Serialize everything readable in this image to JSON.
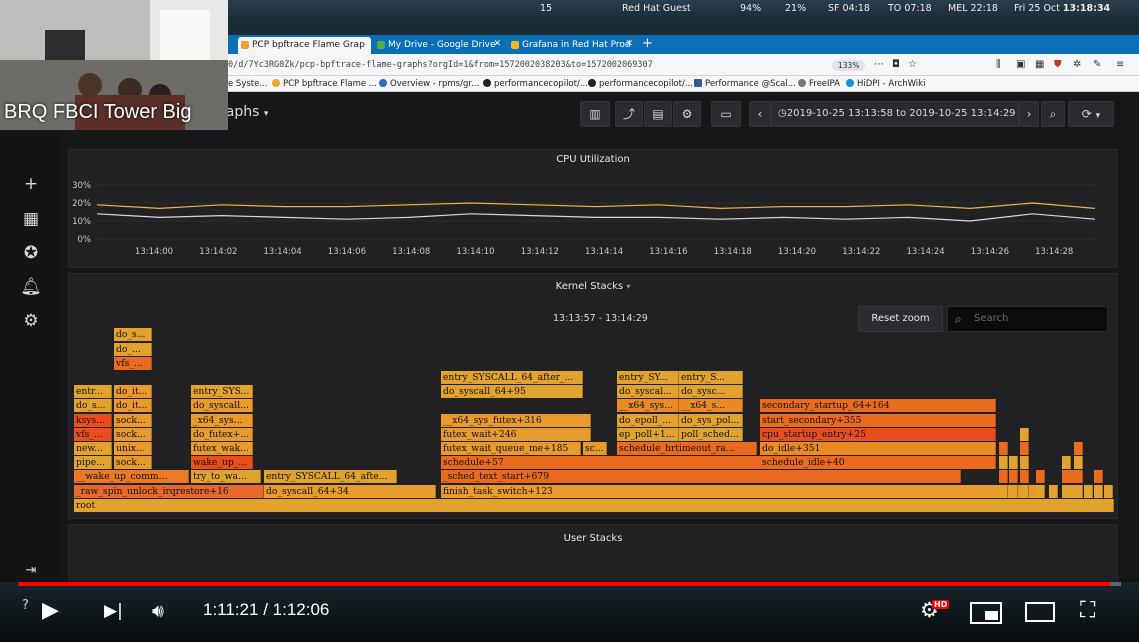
{
  "os_bar": {
    "left_num": "15",
    "user": "Red Hat Guest",
    "battery": "94%",
    "cpu": "21%",
    "clocks": [
      {
        "label": "SF",
        "time": "04:18"
      },
      {
        "label": "TO",
        "time": "07:18"
      },
      {
        "label": "MEL",
        "time": "22:18"
      }
    ],
    "date": "Fri 25 Oct",
    "date_time": "13:18:34"
  },
  "browser": {
    "tabs": [
      {
        "label": "PCP bpftrace Flame Grap",
        "active": true,
        "icon_color": "#f0a030"
      },
      {
        "label": "My Drive - Google Drive",
        "active": false,
        "icon_color": "#4caf50"
      },
      {
        "label": "Grafana in Red Hat Prod",
        "active": false,
        "icon_color": "#f5b623"
      }
    ],
    "url": "0/d/7Yc3RG0Zk/pcp-bpftrace-flame-graphs?orgId=1&from=1572002038203&to=1572002069307",
    "zoom": "133%",
    "bookmarks": [
      {
        "label": "e Syste...",
        "color": "#e0e0e0"
      },
      {
        "label": "PCP bpftrace Flame ...",
        "color": "#f0a030"
      },
      {
        "label": "Overview - rpms/gr...",
        "color": "#3366cc"
      },
      {
        "label": "performancecopilot/...",
        "color": "#222222"
      },
      {
        "label": "performancecopilot/...",
        "color": "#222222"
      },
      {
        "label": "Performance @Scal...",
        "color": "#3b5998"
      },
      {
        "label": "FreeIPA",
        "color": "#777777"
      },
      {
        "label": "HiDPI - ArchWiki",
        "color": "#1793d1"
      }
    ]
  },
  "grafana": {
    "dashboard_title": "raphs",
    "time_range": "2019-10-25 13:13:58 to 2019-10-25 13:14:29",
    "side_icons": [
      "plus-icon",
      "dashboards-icon",
      "explore-icon",
      "alerting-icon",
      "settings-icon",
      "signin-icon"
    ],
    "cpu_panel": {
      "title": "CPU Utilization",
      "y_ticks": [
        "30%",
        "20%",
        "10%",
        "0%"
      ],
      "x_ticks": [
        "13:14:00",
        "13:14:02",
        "13:14:04",
        "13:14:06",
        "13:14:08",
        "13:14:10",
        "13:14:12",
        "13:14:14",
        "13:14:16",
        "13:14:18",
        "13:14:20",
        "13:14:22",
        "13:14:24",
        "13:14:26",
        "13:14:28"
      ]
    },
    "kernel_panel": {
      "title": "Kernel Stacks",
      "reset_zoom": "Reset zoom",
      "search_placeholder": "Search",
      "time_label": "13:13:57 - 13:14:29"
    },
    "user_panel": {
      "title": "User Stacks"
    }
  },
  "chart_data": {
    "type": "line",
    "title": "CPU Utilization",
    "xlabel": "",
    "ylabel": "",
    "ylim": [
      0,
      30
    ],
    "x": [
      "13:13:58",
      "13:14:00",
      "13:14:02",
      "13:14:04",
      "13:14:06",
      "13:14:08",
      "13:14:10",
      "13:14:12",
      "13:14:14",
      "13:14:16",
      "13:14:18",
      "13:14:20",
      "13:14:22",
      "13:14:24",
      "13:14:26",
      "13:14:28",
      "13:14:29"
    ],
    "series": [
      {
        "color": "#eab839",
        "values": [
          19,
          17,
          19,
          18,
          18,
          19,
          20,
          19,
          18,
          19,
          17,
          18,
          18,
          19,
          17,
          20,
          17
        ]
      },
      {
        "color": "#d8d9da",
        "values": [
          14,
          12,
          13,
          12,
          11,
          12,
          14,
          13,
          12,
          12,
          11,
          12,
          11,
          12,
          10,
          14,
          11
        ]
      }
    ],
    "grid": true
  },
  "flame_frames": [
    {
      "row": 0,
      "start": 0,
      "width": 1040,
      "label": "root",
      "color": "#e2a32e"
    },
    {
      "row": 1,
      "start": 0,
      "width": 190,
      "label": "_raw_spin_unlock_irqrestore+16",
      "color": "#e8692a"
    },
    {
      "row": 1,
      "start": 190,
      "width": 172,
      "label": "do_syscall_64+34",
      "color": "#e89a2c"
    },
    {
      "row": 1,
      "start": 367,
      "width": 600,
      "label": "finish_task_switch+123",
      "color": "#e89a2c"
    },
    {
      "row": 2,
      "start": 0,
      "width": 115,
      "label": "__wake_up_comm...",
      "color": "#ec7a24"
    },
    {
      "row": 2,
      "start": 117,
      "width": 70,
      "label": "try_to_wa...",
      "color": "#e2a32e"
    },
    {
      "row": 2,
      "start": 190,
      "width": 133,
      "label": "entry_SYSCALL_64_afte...",
      "color": "#e2a32e"
    },
    {
      "row": 2,
      "start": 367,
      "width": 520,
      "label": "_sched_text_start+679",
      "color": "#ea6b1e"
    },
    {
      "row": 3,
      "start": 0,
      "width": 38,
      "label": "pipe...",
      "color": "#e2a32e"
    },
    {
      "row": 3,
      "start": 40,
      "width": 38,
      "label": "sock...",
      "color": "#e89a2c"
    },
    {
      "row": 3,
      "start": 117,
      "width": 62,
      "label": "wake_up_...",
      "color": "#ea4e1c"
    },
    {
      "row": 3,
      "start": 367,
      "width": 320,
      "label": "schedule+57",
      "color": "#ea6b1e"
    },
    {
      "row": 3,
      "start": 686,
      "width": 236,
      "label": "schedule_idle+40",
      "color": "#ea6b1e"
    },
    {
      "row": 4,
      "start": 0,
      "width": 38,
      "label": "new...",
      "color": "#e2a32e"
    },
    {
      "row": 4,
      "start": 40,
      "width": 38,
      "label": "unix...",
      "color": "#e89a2c"
    },
    {
      "row": 4,
      "start": 117,
      "width": 62,
      "label": "futex_wak...",
      "color": "#e89a2c"
    },
    {
      "row": 4,
      "start": 367,
      "width": 140,
      "label": "futex_wait_queue_me+185",
      "color": "#e89a2c"
    },
    {
      "row": 4,
      "start": 509,
      "width": 24,
      "label": "sc...",
      "color": "#e89a2c"
    },
    {
      "row": 4,
      "start": 543,
      "width": 140,
      "label": "schedule_hrtimeout_ra...",
      "color": "#ea6b1e"
    },
    {
      "row": 4,
      "start": 686,
      "width": 236,
      "label": "do_idle+351",
      "color": "#ea8a24"
    },
    {
      "row": 5,
      "start": 0,
      "width": 38,
      "label": "vfs_...",
      "color": "#ea4e1c"
    },
    {
      "row": 5,
      "start": 40,
      "width": 38,
      "label": "sock...",
      "color": "#e89a2c"
    },
    {
      "row": 5,
      "start": 117,
      "width": 62,
      "label": "do_futex+...",
      "color": "#e89a2c"
    },
    {
      "row": 5,
      "start": 367,
      "width": 150,
      "label": "futex_wait+246",
      "color": "#e89a2c"
    },
    {
      "row": 5,
      "start": 543,
      "width": 62,
      "label": "ep_poll+1...",
      "color": "#e2a32e"
    },
    {
      "row": 5,
      "start": 605,
      "width": 64,
      "label": "poll_sched...",
      "color": "#e2a32e"
    },
    {
      "row": 5,
      "start": 686,
      "width": 236,
      "label": "cpu_startup_entry+25",
      "color": "#ea4e1c"
    },
    {
      "row": 6,
      "start": 0,
      "width": 38,
      "label": "ksys...",
      "color": "#ea4e1c"
    },
    {
      "row": 6,
      "start": 40,
      "width": 38,
      "label": "sock...",
      "color": "#e89a2c"
    },
    {
      "row": 6,
      "start": 117,
      "width": 62,
      "label": "_x64_sys...",
      "color": "#e89a2c"
    },
    {
      "row": 6,
      "start": 367,
      "width": 150,
      "label": "__x64_sys_futex+316",
      "color": "#e89a2c"
    },
    {
      "row": 6,
      "start": 543,
      "width": 62,
      "label": "do_epoll_...",
      "color": "#e2a32e"
    },
    {
      "row": 6,
      "start": 605,
      "width": 64,
      "label": "do_sys_pol...",
      "color": "#e2a32e"
    },
    {
      "row": 6,
      "start": 686,
      "width": 236,
      "label": "start_secondary+355",
      "color": "#ea6b1e"
    },
    {
      "row": 7,
      "start": 0,
      "width": 38,
      "label": "do_s...",
      "color": "#e2a32e"
    },
    {
      "row": 7,
      "start": 40,
      "width": 38,
      "label": "do_it...",
      "color": "#e89a2c"
    },
    {
      "row": 7,
      "start": 117,
      "width": 62,
      "label": "do_syscall...",
      "color": "#e89a2c"
    },
    {
      "row": 7,
      "start": 543,
      "width": 62,
      "label": "__x64_sys...",
      "color": "#ea8a24"
    },
    {
      "row": 7,
      "start": 605,
      "width": 64,
      "label": "__x64_s...",
      "color": "#ea8a24"
    },
    {
      "row": 7,
      "start": 686,
      "width": 236,
      "label": "secondary_startup_64+164",
      "color": "#ea6b1e"
    },
    {
      "row": 8,
      "start": 0,
      "width": 38,
      "label": "entr...",
      "color": "#e2a32e"
    },
    {
      "row": 8,
      "start": 40,
      "width": 38,
      "label": "do_it...",
      "color": "#e89a2c"
    },
    {
      "row": 8,
      "start": 117,
      "width": 62,
      "label": "entry_SYS...",
      "color": "#e2a32e"
    },
    {
      "row": 8,
      "start": 367,
      "width": 142,
      "label": "do_syscall_64+95",
      "color": "#e2a32e"
    },
    {
      "row": 8,
      "start": 543,
      "width": 62,
      "label": "do_syscal...",
      "color": "#e2a32e"
    },
    {
      "row": 8,
      "start": 605,
      "width": 64,
      "label": "do_sysc...",
      "color": "#e2a32e"
    },
    {
      "row": 9,
      "start": 367,
      "width": 142,
      "label": "entry_SYSCALL_64_after_...",
      "color": "#e2a32e"
    },
    {
      "row": 9,
      "start": 543,
      "width": 62,
      "label": "entry_SY...",
      "color": "#e2a32e"
    },
    {
      "row": 9,
      "start": 605,
      "width": 64,
      "label": "entry_S...",
      "color": "#e2a32e"
    },
    {
      "row": 10,
      "start": 40,
      "width": 38,
      "label": "vfs_...",
      "color": "#ea6b1e"
    },
    {
      "row": 11,
      "start": 40,
      "width": 38,
      "label": "do_...",
      "color": "#e2a32e"
    },
    {
      "row": 12,
      "start": 40,
      "width": 38,
      "label": "do_s...",
      "color": "#e2a32e"
    }
  ],
  "video": {
    "cam_label": "BRQ FBCI Tower Big",
    "time_current": "1:11:21",
    "time_total": "1:12:06",
    "progress": 0.99,
    "hd_badge": "HD"
  }
}
